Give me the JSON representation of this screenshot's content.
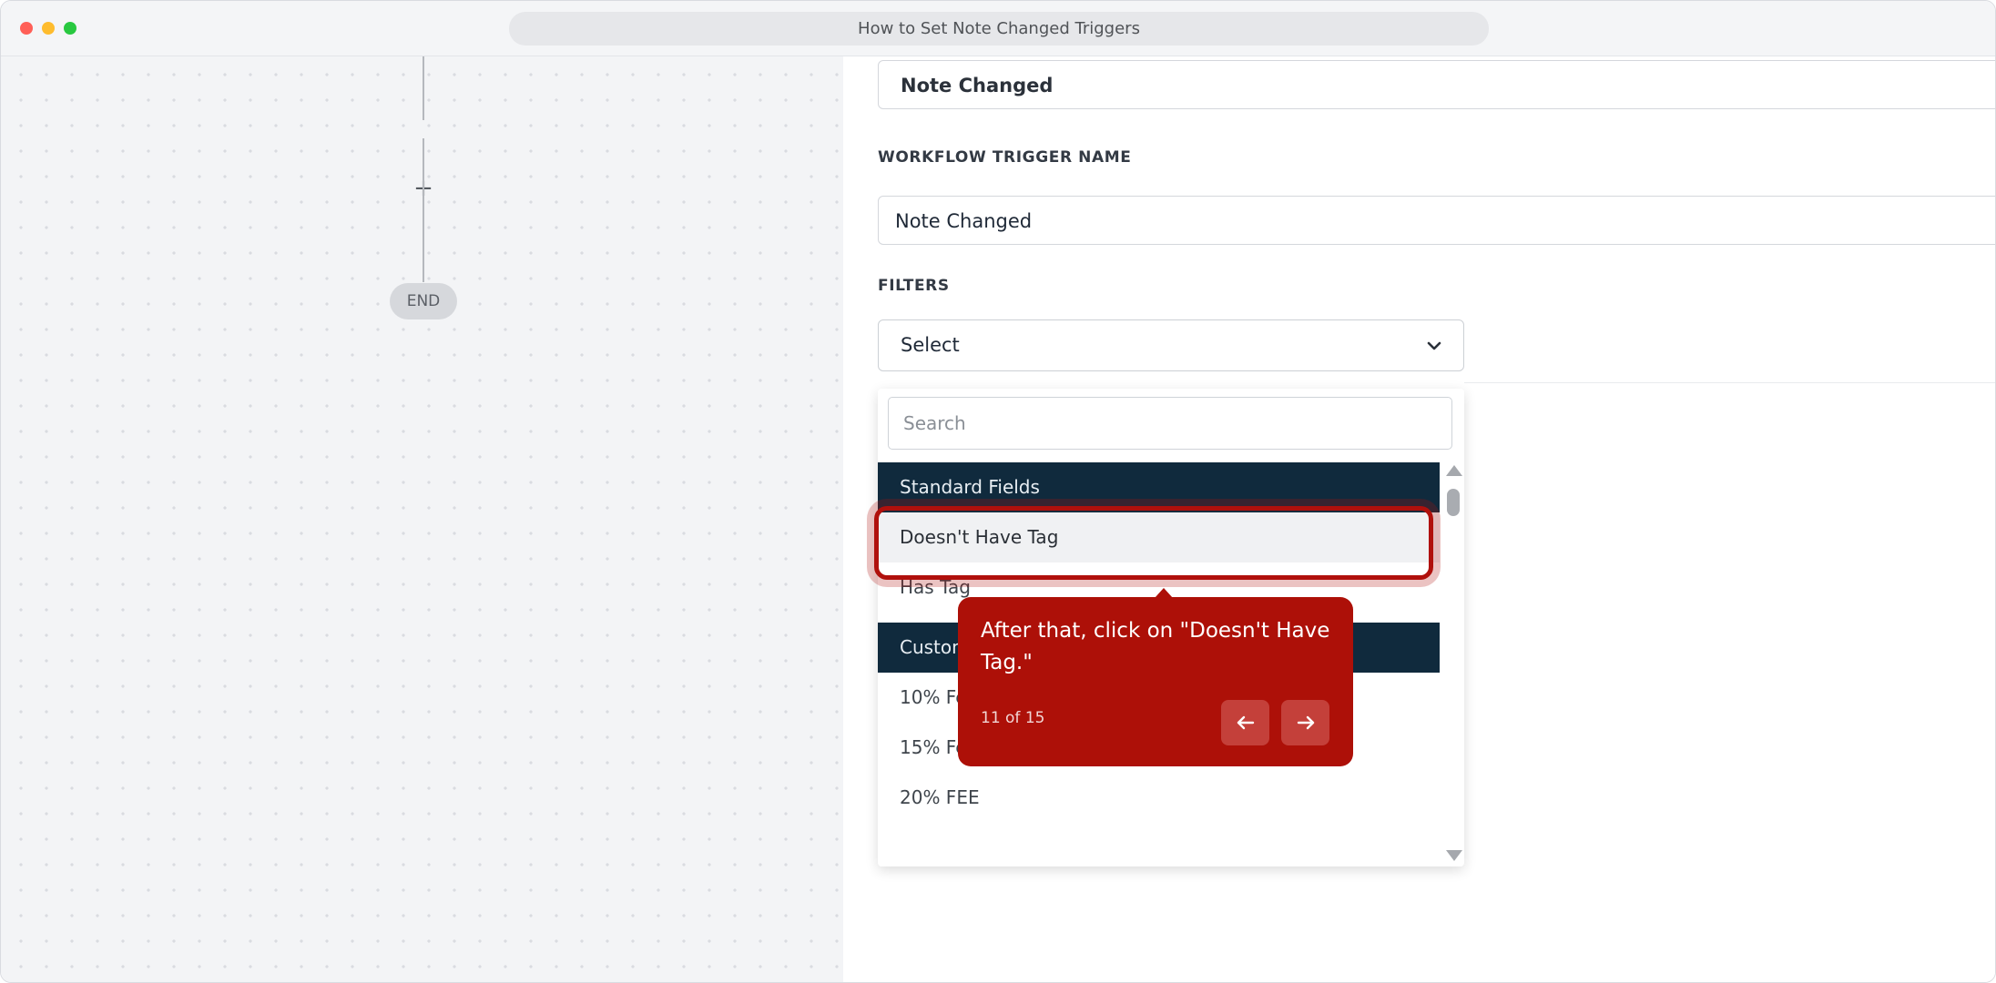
{
  "window": {
    "title": "How to Set Note Changed Triggers"
  },
  "canvas": {
    "plus_symbol": "+",
    "end_label": "END"
  },
  "panel": {
    "trigger_type_value": "Note Changed",
    "trigger_name_label": "WORKFLOW TRIGGER NAME",
    "trigger_name_value": "Note Changed",
    "filters_label": "FILTERS",
    "filters_select_value": "Select"
  },
  "dropdown": {
    "search_placeholder": "Search",
    "groups": [
      {
        "header": "Standard Fields",
        "options": [
          "Doesn't Have Tag",
          "Has Tag"
        ]
      },
      {
        "header": "Custom",
        "options": [
          "10% Fe",
          "15% Fe",
          "20% FEE"
        ]
      }
    ]
  },
  "tooltip": {
    "text": "After that, click on \"Doesn't Have Tag.\"",
    "counter": "11 of 15",
    "accent_color": "#ad1008"
  },
  "icons": {
    "window_controls": [
      "close",
      "minimize",
      "maximize"
    ],
    "chevron": "chevron-down-icon",
    "nav_prev": "arrow-left-icon",
    "nav_next": "arrow-right-icon"
  }
}
